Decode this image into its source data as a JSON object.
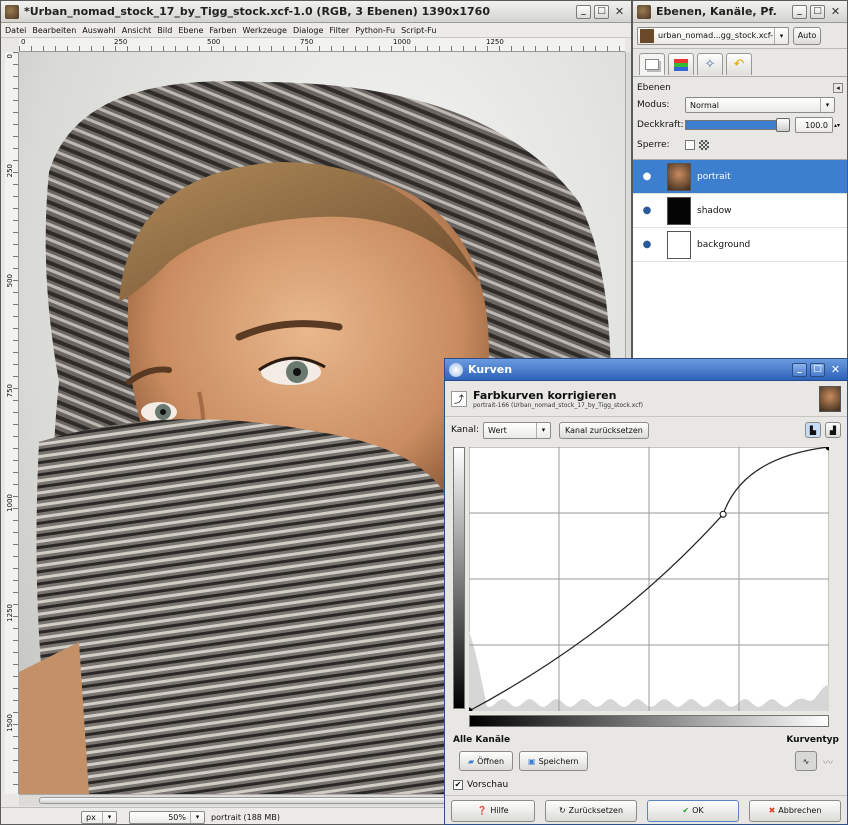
{
  "main_window": {
    "title": "*Urban_nomad_stock_17_by_Tigg_stock.xcf-1.0 (RGB, 3 Ebenen) 1390x1760",
    "menu": [
      "Datei",
      "Bearbeiten",
      "Auswahl",
      "Ansicht",
      "Bild",
      "Ebene",
      "Farben",
      "Werkzeuge",
      "Dialoge",
      "Filter",
      "Python-Fu",
      "Script-Fu"
    ],
    "ruler_h": [
      "0",
      "250",
      "500",
      "750",
      "1000",
      "1250"
    ],
    "ruler_v": [
      "0",
      "250",
      "500",
      "750",
      "1000",
      "1250",
      "1500"
    ],
    "status": {
      "unit": "px",
      "zoom": "50%",
      "info": "portrait (188 MB)"
    }
  },
  "layers_dock": {
    "title": "Ebenen, Kanäle, Pf.",
    "image_select": "urban_nomad...gg_stock.xcf-1",
    "auto_label": "Auto",
    "section": "Ebenen",
    "mode_label": "Modus:",
    "mode_value": "Normal",
    "opacity_label": "Deckkraft:",
    "opacity_value": "100.0",
    "opacity_level": 1.0,
    "lock_label": "Sperre:",
    "layers": [
      {
        "name": "portrait",
        "selected": true
      },
      {
        "name": "shadow",
        "selected": false
      },
      {
        "name": "background",
        "selected": false
      }
    ]
  },
  "curves_dialog": {
    "title": "Kurven",
    "heading": "Farbkurven korrigieren",
    "subheading": "portrait-166 (Urban_nomad_stock_17_by_Tigg_stock.xcf)",
    "channel_label": "Kanal:",
    "channel_value": "Wert",
    "reset_channel": "Kanal zurücksetzen",
    "all_channels": "Alle Kanäle",
    "curve_type": "Kurventyp",
    "open_btn": "Öffnen",
    "save_btn": "Speichern",
    "preview_label": "Vorschau",
    "preview_checked": true,
    "buttons": {
      "help": "Hilfe",
      "reset": "Zurücksetzen",
      "ok": "OK",
      "cancel": "Abbrechen"
    },
    "curve_points": [
      [
        0,
        0
      ],
      [
        180,
        190
      ],
      [
        255,
        255
      ]
    ]
  }
}
